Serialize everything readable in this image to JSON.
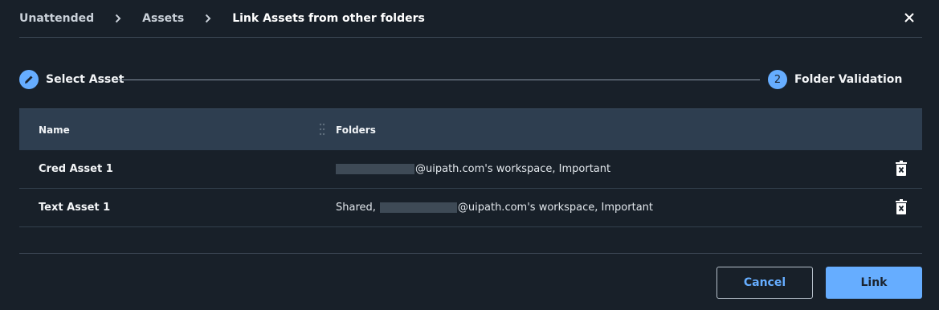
{
  "breadcrumb": {
    "items": [
      "Unattended",
      "Assets",
      "Link Assets from other folders"
    ]
  },
  "stepper": {
    "step1": {
      "label": "Select Asset",
      "icon": "pencil-icon"
    },
    "step2": {
      "number": "2",
      "label": "Folder Validation"
    }
  },
  "table": {
    "columns": [
      "Name",
      "Folders"
    ],
    "rows": [
      {
        "name": "Cred Asset 1",
        "folders_prefix": "",
        "folders_suffix": "@uipath.com's workspace, Important"
      },
      {
        "name": "Text Asset 1",
        "folders_prefix": "Shared,",
        "folders_suffix": "@uipath.com's workspace, Important"
      }
    ]
  },
  "footer": {
    "cancel_label": "Cancel",
    "link_label": "Link"
  },
  "colors": {
    "background": "#182029",
    "accent": "#66adff",
    "header_row": "#2e3e50"
  }
}
